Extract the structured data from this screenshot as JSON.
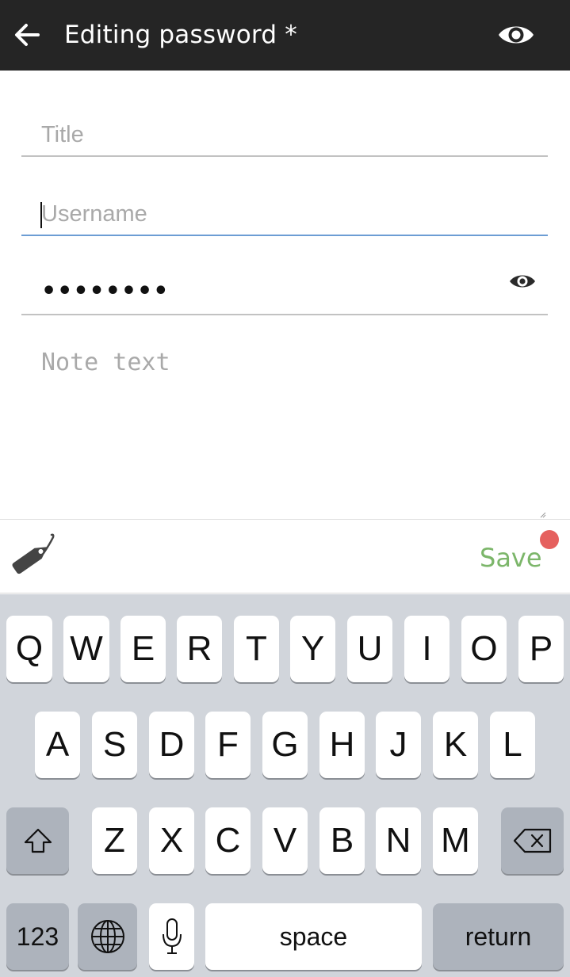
{
  "header": {
    "title": "Editing password *",
    "back_icon": "arrow-left-icon",
    "visibility_icon": "eye-icon"
  },
  "form": {
    "title_placeholder": "Title",
    "title_value": "",
    "username_placeholder": "Username",
    "username_value": "",
    "password_masked": "••••••••",
    "password_visibility_icon": "eye-icon",
    "note_placeholder": "Note text",
    "note_value": ""
  },
  "actions": {
    "tag_icon": "tag-icon",
    "save_label": "Save",
    "notification_color": "#e5605e",
    "save_color": "#7cb66a"
  },
  "keyboard": {
    "row1": [
      "Q",
      "W",
      "E",
      "R",
      "T",
      "Y",
      "U",
      "I",
      "O",
      "P"
    ],
    "row2": [
      "A",
      "S",
      "D",
      "F",
      "G",
      "H",
      "J",
      "K",
      "L"
    ],
    "row3": [
      "Z",
      "X",
      "C",
      "V",
      "B",
      "N",
      "M"
    ],
    "shift_icon": "shift-icon",
    "backspace_icon": "backspace-icon",
    "numbers_label": "123",
    "globe_icon": "globe-icon",
    "mic_icon": "microphone-icon",
    "space_label": "space",
    "return_label": "return"
  },
  "colors": {
    "appbar": "#252525",
    "focus_underline": "#6c9dd4",
    "keyboard_bg": "#d1d5db"
  }
}
